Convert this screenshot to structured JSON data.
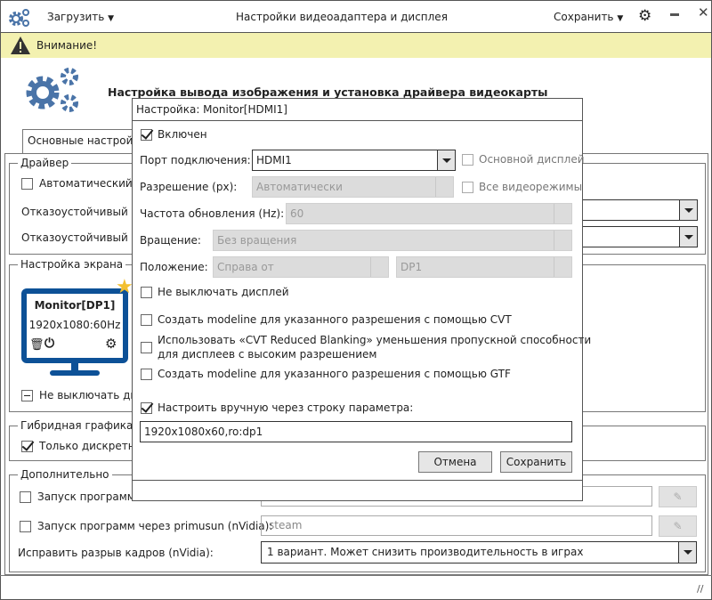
{
  "titlebar": {
    "title": "Настройки видеоадаптера и дисплея",
    "load": "Загрузить",
    "save": "Сохранить",
    "icons": [
      "gears-icon",
      "gear-icon",
      "minimize-icon",
      "close-icon"
    ]
  },
  "banner": {
    "text": "Внимание!",
    "color": "#f3f1b0"
  },
  "header": {
    "heading": "Настройка вывода изображения и установка драйвера видеокарты",
    "accent": "#4a74a8"
  },
  "tabs": [
    {
      "label": "Основные настройки"
    }
  ],
  "driver": {
    "legend": "Драйвер",
    "auto": "Автоматический в",
    "failsafe1": "Отказоустойчивый др",
    "failsafe2": "Отказоустойчивый др"
  },
  "screen": {
    "legend": "Настройка экрана",
    "monitor_name": "Monitor[DP1]",
    "monitor_mode": "1920x1080:60Hz",
    "monitor_color": "#0d5197",
    "star_color": "#f3c030",
    "keep_on": "Не выключать ди"
  },
  "hybrid": {
    "legend": "Гибридная графика",
    "discrete": "Только дискретно"
  },
  "extra": {
    "legend": "Дополнительно",
    "run1": "Запуск программ ч",
    "run2": "Запуск программ через primusun (nVidia):",
    "run2_value": "steam",
    "tearing_label": "Исправить разрыв кадров (nVidia):",
    "tearing_value": "1 вариант. Может снизить производительность в играх"
  },
  "dialog": {
    "title": "Настройка: Monitor[HDMI1]",
    "enabled": "Включен",
    "port_label": "Порт подключения:",
    "port_value": "HDMI1",
    "primary": "Основной дисплей",
    "res_label": "Разрешение (px):",
    "res_value": "Автоматически",
    "all_modes": "Все видеорежимы",
    "rate_label": "Частота обновления (Hz):",
    "rate_value": "60",
    "rot_label": "Вращение:",
    "rot_value": "Без вращения",
    "pos_label": "Положение:",
    "pos_value": "Справа от",
    "pos_target": "DP1",
    "keep_on": "Не выключать дисплей",
    "cvt": "Создать modeline для указанного разрешения с помощью CVT",
    "cvt_rb1": "Использовать «CVT Reduced Blanking» уменьшения пропускной способности",
    "cvt_rb2": "для дисплеев с высоким разрешением",
    "gtf": "Создать modeline для указанного разрешения с помощью GTF",
    "manual": "Настроить вручную через строку параметра:",
    "manual_value": "1920x1080x60,ro:dp1",
    "cancel": "Отмена",
    "save": "Сохранить"
  }
}
